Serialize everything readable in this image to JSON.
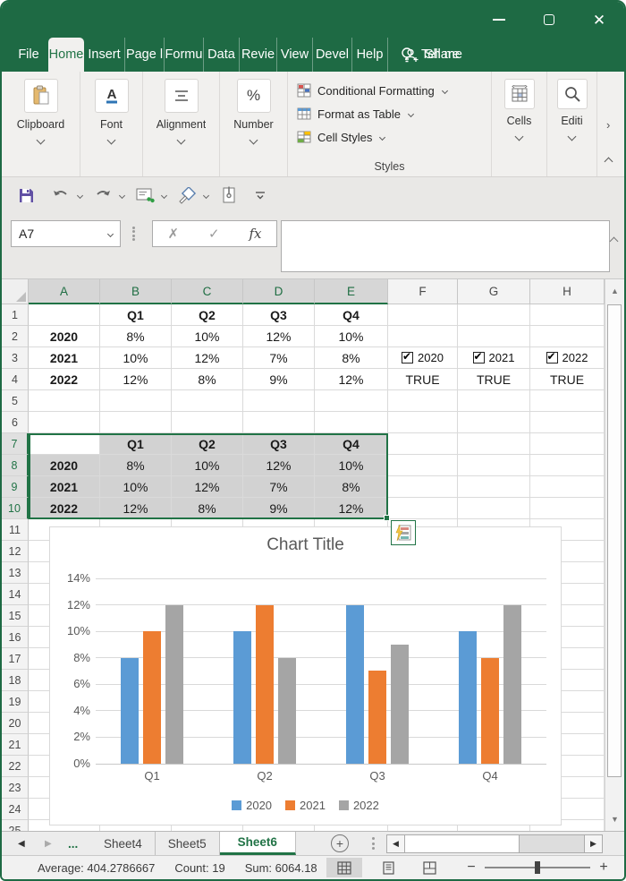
{
  "colors": {
    "accent": "#217346",
    "titlebar_green": "#1E6A44",
    "series_blue": "#5B9BD5",
    "series_orange": "#ED7D31",
    "series_gray": "#A5A5A5"
  },
  "titlebar": {
    "controls": [
      "minimize",
      "maximize",
      "close"
    ]
  },
  "menu": {
    "tabs": [
      {
        "label": "File"
      },
      {
        "label": "Home",
        "active": true
      },
      {
        "label": "Insert"
      },
      {
        "label": "Page l"
      },
      {
        "label": "Formu"
      },
      {
        "label": "Data"
      },
      {
        "label": "Revie"
      },
      {
        "label": "View"
      },
      {
        "label": "Devel"
      },
      {
        "label": "Help"
      }
    ],
    "tell_me": "Tell me",
    "share": "Share"
  },
  "ribbon": {
    "groups": [
      {
        "label": "Clipboard"
      },
      {
        "label": "Font"
      },
      {
        "label": "Alignment"
      },
      {
        "label": "Number"
      }
    ],
    "styles": {
      "label": "Styles",
      "buttons": [
        {
          "label": "Conditional Formatting"
        },
        {
          "label": "Format as Table"
        },
        {
          "label": "Cell Styles"
        }
      ]
    },
    "cells_label": "Cells",
    "editing_label": "Editi"
  },
  "name_box": {
    "value": "A7"
  },
  "formula_bar": {
    "value": ""
  },
  "sheet": {
    "columns": [
      {
        "label": "A",
        "selected": true
      },
      {
        "label": "B",
        "selected": true
      },
      {
        "label": "C",
        "selected": true
      },
      {
        "label": "D",
        "selected": true
      },
      {
        "label": "E",
        "selected": true
      },
      {
        "label": "F",
        "selected": false
      },
      {
        "label": "G",
        "selected": false
      },
      {
        "label": "H",
        "selected": false
      }
    ],
    "rows": {
      "count": 25,
      "selected": [
        7,
        8,
        9,
        10
      ]
    },
    "selection_range": "A7:E10",
    "cells": [
      {
        "c": "B",
        "r": 1,
        "t": "Q1",
        "bold": true
      },
      {
        "c": "C",
        "r": 1,
        "t": "Q2",
        "bold": true
      },
      {
        "c": "D",
        "r": 1,
        "t": "Q3",
        "bold": true
      },
      {
        "c": "E",
        "r": 1,
        "t": "Q4",
        "bold": true
      },
      {
        "c": "A",
        "r": 2,
        "t": "2020",
        "bold": true
      },
      {
        "c": "B",
        "r": 2,
        "t": "8%"
      },
      {
        "c": "C",
        "r": 2,
        "t": "10%"
      },
      {
        "c": "D",
        "r": 2,
        "t": "12%"
      },
      {
        "c": "E",
        "r": 2,
        "t": "10%"
      },
      {
        "c": "A",
        "r": 3,
        "t": "2021",
        "bold": true
      },
      {
        "c": "B",
        "r": 3,
        "t": "10%"
      },
      {
        "c": "C",
        "r": 3,
        "t": "12%"
      },
      {
        "c": "D",
        "r": 3,
        "t": "7%"
      },
      {
        "c": "E",
        "r": 3,
        "t": "8%"
      },
      {
        "c": "F",
        "r": 3,
        "t": "2020",
        "checkbox": true,
        "checked": true
      },
      {
        "c": "G",
        "r": 3,
        "t": "2021",
        "checkbox": true,
        "checked": true
      },
      {
        "c": "H",
        "r": 3,
        "t": "2022",
        "checkbox": true,
        "checked": true
      },
      {
        "c": "A",
        "r": 4,
        "t": "2022",
        "bold": true
      },
      {
        "c": "B",
        "r": 4,
        "t": "12%"
      },
      {
        "c": "C",
        "r": 4,
        "t": "8%"
      },
      {
        "c": "D",
        "r": 4,
        "t": "9%"
      },
      {
        "c": "E",
        "r": 4,
        "t": "12%"
      },
      {
        "c": "F",
        "r": 4,
        "t": "TRUE"
      },
      {
        "c": "G",
        "r": 4,
        "t": "TRUE"
      },
      {
        "c": "H",
        "r": 4,
        "t": "TRUE"
      },
      {
        "c": "A",
        "r": 7,
        "t": "",
        "active": true
      },
      {
        "c": "B",
        "r": 7,
        "t": "Q1",
        "bold": true,
        "sel": true
      },
      {
        "c": "C",
        "r": 7,
        "t": "Q2",
        "bold": true,
        "sel": true
      },
      {
        "c": "D",
        "r": 7,
        "t": "Q3",
        "bold": true,
        "sel": true
      },
      {
        "c": "E",
        "r": 7,
        "t": "Q4",
        "bold": true,
        "sel": true
      },
      {
        "c": "A",
        "r": 8,
        "t": "2020",
        "bold": true,
        "sel": true
      },
      {
        "c": "B",
        "r": 8,
        "t": "8%",
        "sel": true
      },
      {
        "c": "C",
        "r": 8,
        "t": "10%",
        "sel": true
      },
      {
        "c": "D",
        "r": 8,
        "t": "12%",
        "sel": true
      },
      {
        "c": "E",
        "r": 8,
        "t": "10%",
        "sel": true
      },
      {
        "c": "A",
        "r": 9,
        "t": "2021",
        "bold": true,
        "sel": true
      },
      {
        "c": "B",
        "r": 9,
        "t": "10%",
        "sel": true
      },
      {
        "c": "C",
        "r": 9,
        "t": "12%",
        "sel": true
      },
      {
        "c": "D",
        "r": 9,
        "t": "7%",
        "sel": true
      },
      {
        "c": "E",
        "r": 9,
        "t": "8%",
        "sel": true
      },
      {
        "c": "A",
        "r": 10,
        "t": "2022",
        "bold": true,
        "sel": true
      },
      {
        "c": "B",
        "r": 10,
        "t": "12%",
        "sel": true
      },
      {
        "c": "C",
        "r": 10,
        "t": "8%",
        "sel": true
      },
      {
        "c": "D",
        "r": 10,
        "t": "9%",
        "sel": true
      },
      {
        "c": "E",
        "r": 10,
        "t": "12%",
        "sel": true
      }
    ]
  },
  "chart_data": {
    "type": "bar",
    "title": "Chart Title",
    "categories": [
      "Q1",
      "Q2",
      "Q3",
      "Q4"
    ],
    "series": [
      {
        "name": "2020",
        "color": "#5B9BD5",
        "values": [
          8,
          10,
          12,
          10
        ]
      },
      {
        "name": "2021",
        "color": "#ED7D31",
        "values": [
          10,
          12,
          7,
          8
        ]
      },
      {
        "name": "2022",
        "color": "#A5A5A5",
        "values": [
          12,
          8,
          9,
          12
        ]
      }
    ],
    "ylim": [
      0,
      14
    ],
    "ytick_step": 2,
    "ytick_format": "percent",
    "grid": true,
    "legend_position": "bottom"
  },
  "sheet_tabs": {
    "ellipsis": "...",
    "tabs": [
      {
        "label": "Sheet4"
      },
      {
        "label": "Sheet5"
      },
      {
        "label": "Sheet6",
        "active": true
      }
    ]
  },
  "status_bar": {
    "items": [
      {
        "label": "Average: 404.2786667"
      },
      {
        "label": "Count: 19"
      },
      {
        "label": "Sum: 6064.18"
      }
    ],
    "views": [
      "normal-view",
      "page-layout-view",
      "page-break-preview"
    ],
    "zoom_out": "−",
    "zoom_in": "+"
  }
}
